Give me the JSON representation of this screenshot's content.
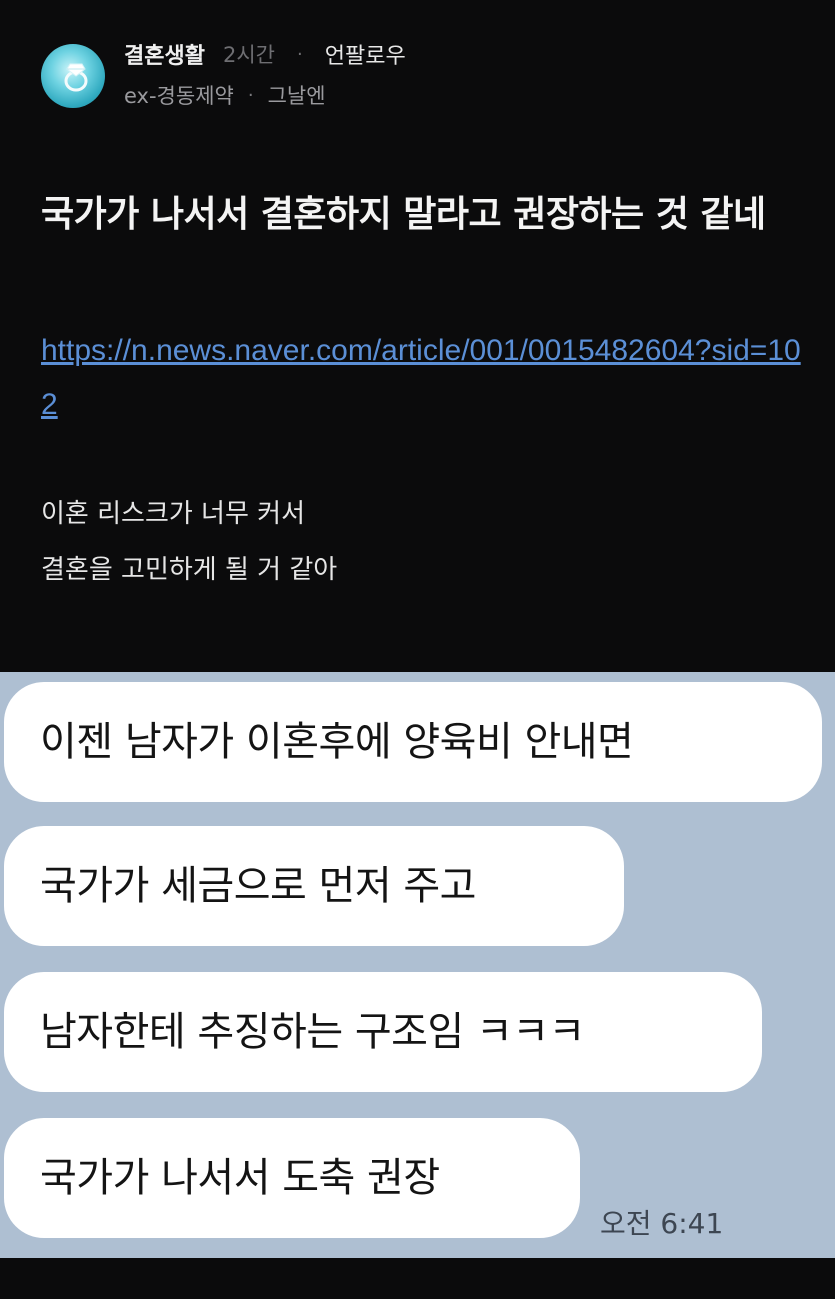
{
  "post": {
    "board": "결혼생활",
    "time_ago": "2시간",
    "follow_label": "언팔로우",
    "company": "ex-경동제약",
    "nickname": "그날엔",
    "separator": "·",
    "title": "국가가 나서서 결혼하지 말라고 권장하는 것 같네",
    "link": "https://n.news.naver.com/article/001/0015482604?sid=102",
    "body_lines": [
      "이혼 리스크가 너무 커서",
      "결혼을 고민하게 될 거 같아"
    ]
  },
  "chat": {
    "messages": [
      "이젠 남자가 이혼후에 양육비 안내면",
      "국가가 세금으로 먼저 주고",
      "남자한테 추징하는 구조임 ㅋㅋㅋ",
      "국가가 나서서 도축 권장"
    ],
    "timestamp": "오전 6:41",
    "background_color": "#aebfd2"
  },
  "icons": {
    "avatar": "diamond-ring-icon"
  }
}
